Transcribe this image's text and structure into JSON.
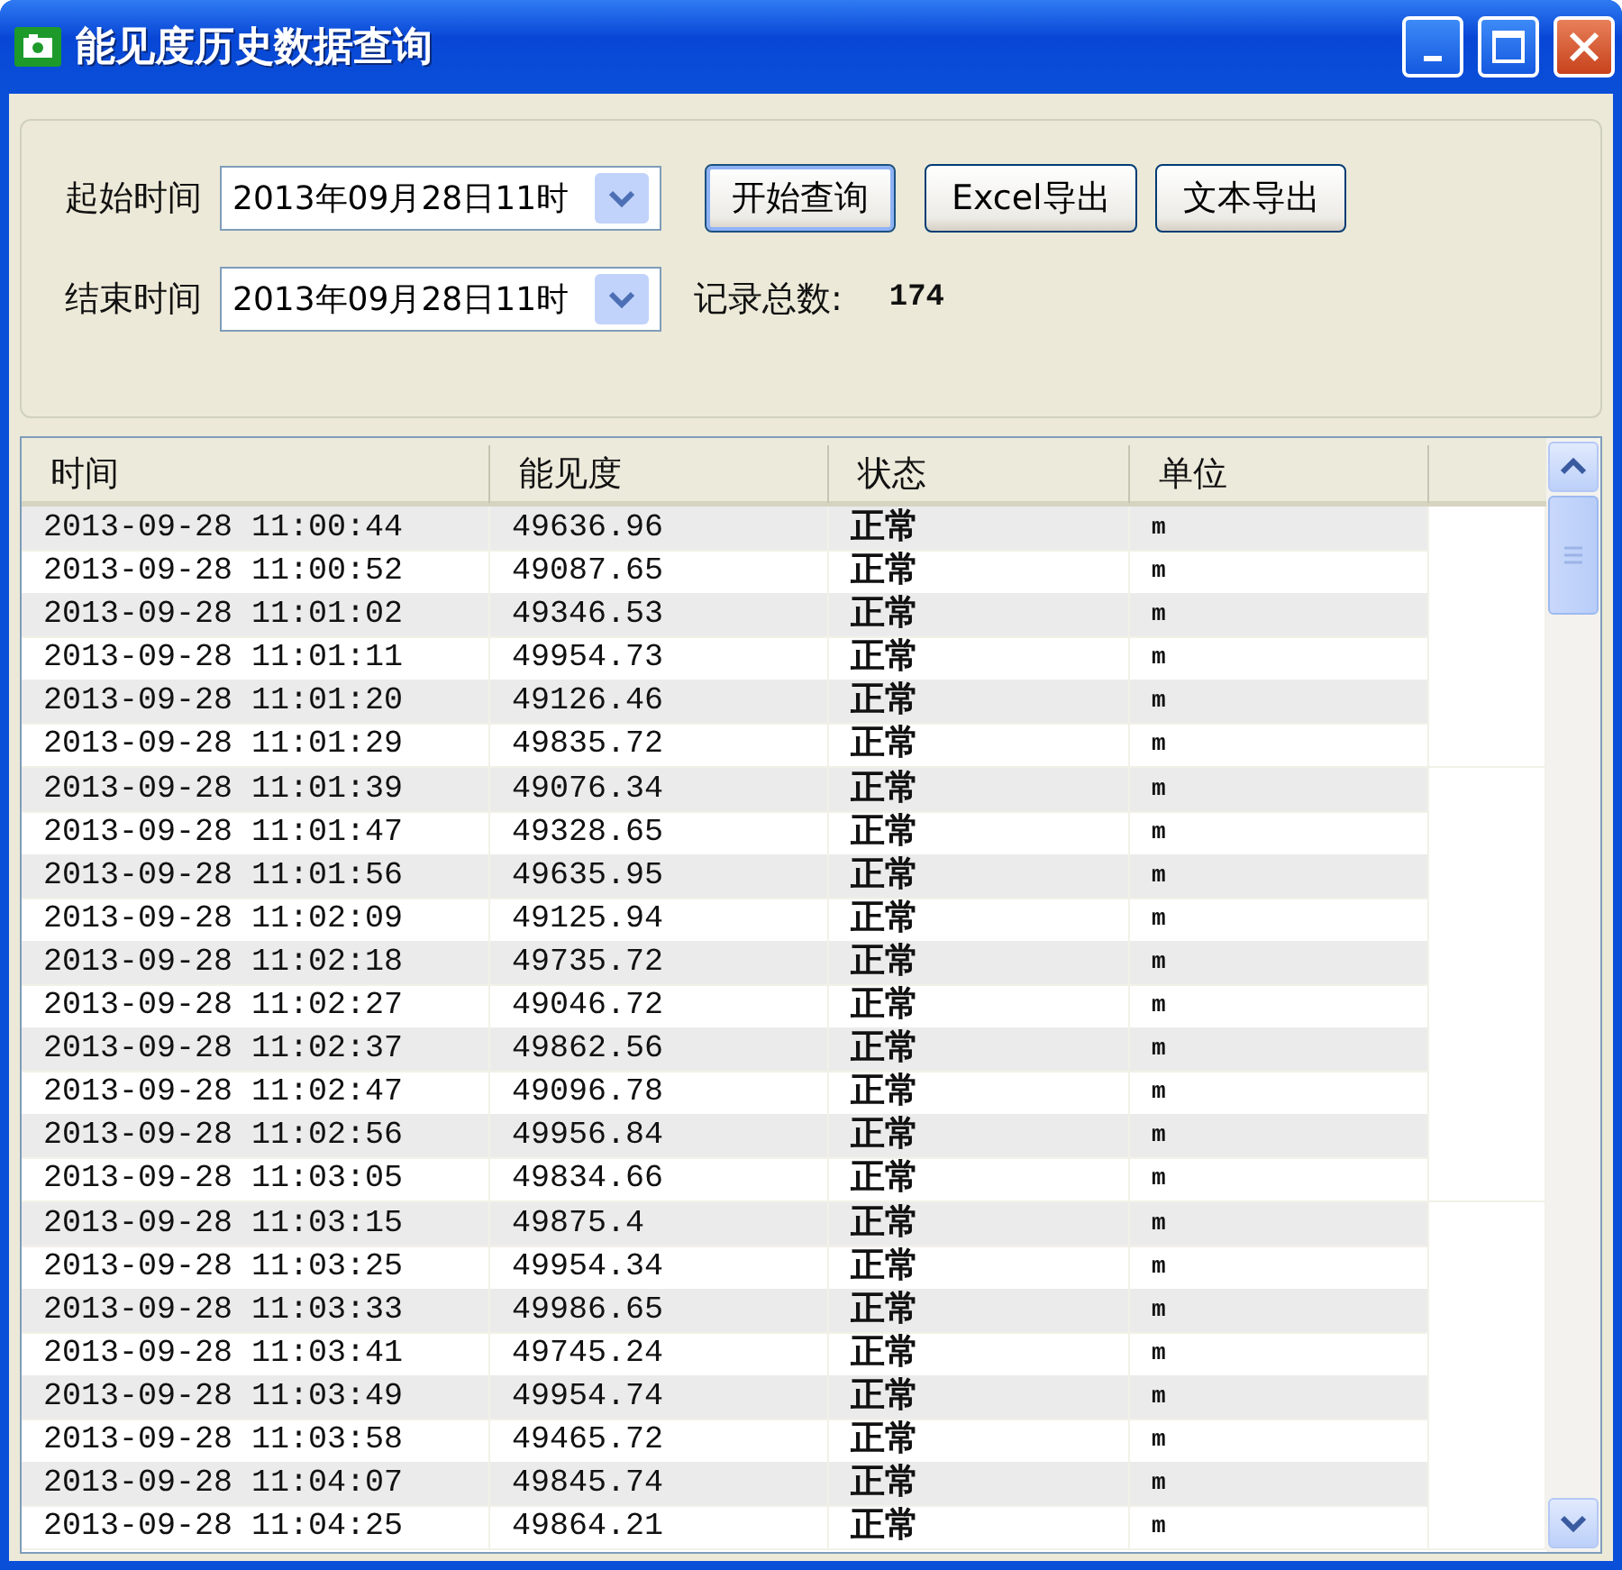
{
  "window": {
    "title": "能见度历史数据查询"
  },
  "query": {
    "start_label": "起始时间",
    "start_value": "2013年09月28日11时",
    "end_label": "结束时间",
    "end_value": "2013年09月28日11时",
    "count_label": "记录总数:",
    "count": "174",
    "buttons": [
      {
        "label": "开始查询",
        "default": true
      },
      {
        "label": "Excel导出",
        "default": false
      },
      {
        "label": "文本导出",
        "default": false
      }
    ]
  },
  "table": {
    "columns": [
      "时间",
      "能见度",
      "状态",
      "单位"
    ],
    "rows": [
      [
        "2013-09-28 11:00:44",
        "49636.96",
        "正常",
        "m"
      ],
      [
        "2013-09-28 11:00:52",
        "49087.65",
        "正常",
        "m"
      ],
      [
        "2013-09-28 11:01:02",
        "49346.53",
        "正常",
        "m"
      ],
      [
        "2013-09-28 11:01:11",
        "49954.73",
        "正常",
        "m"
      ],
      [
        "2013-09-28 11:01:20",
        "49126.46",
        "正常",
        "m"
      ],
      [
        "2013-09-28 11:01:29",
        "49835.72",
        "正常",
        "m"
      ],
      [
        "2013-09-28 11:01:39",
        "49076.34",
        "正常",
        "m"
      ],
      [
        "2013-09-28 11:01:47",
        "49328.65",
        "正常",
        "m"
      ],
      [
        "2013-09-28 11:01:56",
        "49635.95",
        "正常",
        "m"
      ],
      [
        "2013-09-28 11:02:09",
        "49125.94",
        "正常",
        "m"
      ],
      [
        "2013-09-28 11:02:18",
        "49735.72",
        "正常",
        "m"
      ],
      [
        "2013-09-28 11:02:27",
        "49046.72",
        "正常",
        "m"
      ],
      [
        "2013-09-28 11:02:37",
        "49862.56",
        "正常",
        "m"
      ],
      [
        "2013-09-28 11:02:47",
        "49096.78",
        "正常",
        "m"
      ],
      [
        "2013-09-28 11:02:56",
        "49956.84",
        "正常",
        "m"
      ],
      [
        "2013-09-28 11:03:05",
        "49834.66",
        "正常",
        "m"
      ],
      [
        "2013-09-28 11:03:15",
        "49875.4",
        "正常",
        "m"
      ],
      [
        "2013-09-28 11:03:25",
        "49954.34",
        "正常",
        "m"
      ],
      [
        "2013-09-28 11:03:33",
        "49986.65",
        "正常",
        "m"
      ],
      [
        "2013-09-28 11:03:41",
        "49745.24",
        "正常",
        "m"
      ],
      [
        "2013-09-28 11:03:49",
        "49954.74",
        "正常",
        "m"
      ],
      [
        "2013-09-28 11:03:58",
        "49465.72",
        "正常",
        "m"
      ],
      [
        "2013-09-28 11:04:07",
        "49845.74",
        "正常",
        "m"
      ],
      [
        "2013-09-28 11:04:25",
        "49864.21",
        "正常",
        "m"
      ]
    ]
  }
}
